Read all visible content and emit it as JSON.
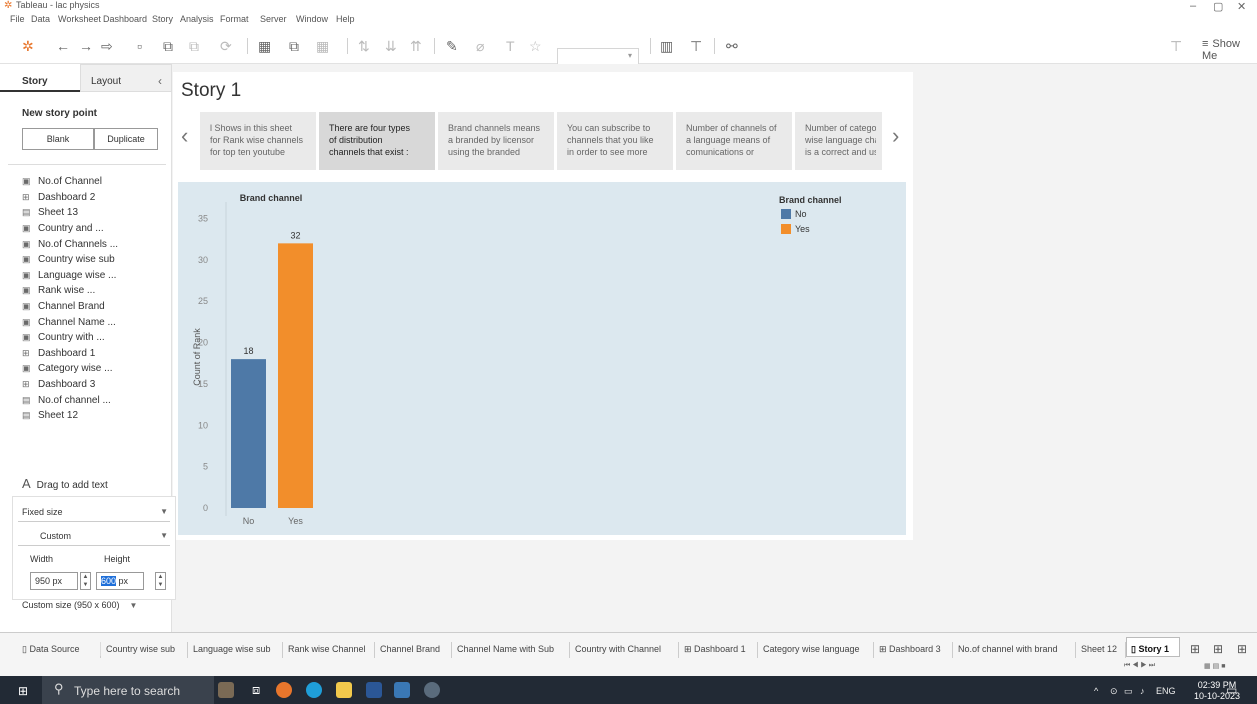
{
  "window": {
    "title": "Tableau - lac physics"
  },
  "menu": [
    "File",
    "Data",
    "Worksheet",
    "Dashboard",
    "Story",
    "Analysis",
    "Format",
    "Server",
    "Window",
    "Help"
  ],
  "toolbar": {
    "show_me": "Show Me"
  },
  "side": {
    "tab_story": "Story",
    "tab_layout": "Layout",
    "new_story_point": "New story point",
    "blank": "Blank",
    "duplicate": "Duplicate",
    "sheets": [
      {
        "label": "No.of Channel",
        "type": "worksheet"
      },
      {
        "label": "Dashboard 2",
        "type": "dashboard"
      },
      {
        "label": "Sheet 13",
        "type": "sheet"
      },
      {
        "label": "Country and ...",
        "type": "worksheet"
      },
      {
        "label": "No.of Channels ...",
        "type": "worksheet"
      },
      {
        "label": "Country wise sub",
        "type": "worksheet"
      },
      {
        "label": "Language wise ...",
        "type": "worksheet"
      },
      {
        "label": "Rank wise ...",
        "type": "worksheet"
      },
      {
        "label": "Channel Brand",
        "type": "worksheet"
      },
      {
        "label": "Channel Name ...",
        "type": "worksheet"
      },
      {
        "label": "Country with ...",
        "type": "worksheet"
      },
      {
        "label": "Dashboard 1",
        "type": "dashboard"
      },
      {
        "label": "Category wise ...",
        "type": "worksheet"
      },
      {
        "label": "Dashboard 3",
        "type": "dashboard"
      },
      {
        "label": "No.of channel ...",
        "type": "sheet"
      },
      {
        "label": "Sheet 12",
        "type": "sheet"
      }
    ],
    "drag_text": "Drag to add text",
    "fixed_size": "Fixed size",
    "custom": "Custom",
    "width_label": "Width",
    "height_label": "Height",
    "width_value": "950 px",
    "height_value_sel": "600",
    "height_value_unit": " px",
    "custom_size": "Custom size (950 x 600)"
  },
  "story": {
    "title": "Story 1",
    "points": [
      {
        "lines": [
          "l Shows in this sheet",
          "for Rank wise channels",
          "for top ten youtube"
        ],
        "active": false
      },
      {
        "lines": [
          "There are four types",
          "of distribution",
          "channels that exist :"
        ],
        "active": true
      },
      {
        "lines": [
          "Brand channels means",
          "a branded by licensor",
          "using the branded"
        ],
        "active": false
      },
      {
        "lines": [
          "You can subscribe to",
          "channels that you like",
          "in order to see more"
        ],
        "active": false
      },
      {
        "lines": [
          "Number of channels of",
          "a language means of",
          "comunications or"
        ],
        "active": false
      },
      {
        "lines": [
          "Number of catego",
          "wise language cha",
          "is a  correct and us"
        ],
        "active": false
      }
    ]
  },
  "chart_data": {
    "type": "bar",
    "title": "Brand channel",
    "categories": [
      "No",
      "Yes"
    ],
    "values": [
      18,
      32
    ],
    "colors": [
      "#4e79a7",
      "#f28e2b"
    ],
    "ylabel": "Count of Rank",
    "xlabel": "",
    "ylim": [
      0,
      37
    ],
    "yticks": [
      0,
      5,
      10,
      15,
      20,
      25,
      30,
      35
    ],
    "legend": {
      "title": "Brand channel",
      "items": [
        "No",
        "Yes"
      ],
      "placement": "top-right"
    },
    "grid": false
  },
  "bottom_tabs": [
    {
      "label": "Data Source",
      "icon": "database-icon"
    },
    {
      "label": "Country wise sub"
    },
    {
      "label": "Language wise sub"
    },
    {
      "label": "Rank wise Channel"
    },
    {
      "label": "Channel Brand"
    },
    {
      "label": "Channel Name with Sub"
    },
    {
      "label": "Country with Channel"
    },
    {
      "label": "Dashboard 1",
      "icon": "dashboard-icon"
    },
    {
      "label": "Category wise language"
    },
    {
      "label": "Dashboard 3",
      "icon": "dashboard-icon"
    },
    {
      "label": "No.of channel with brand"
    },
    {
      "label": "Sheet 12"
    },
    {
      "label": "Story 1",
      "icon": "story-icon",
      "active": true
    }
  ],
  "taskbar": {
    "search_placeholder": "Type here to search",
    "lang": "ENG",
    "time": "02:39 PM",
    "date": "10-10-2023"
  }
}
